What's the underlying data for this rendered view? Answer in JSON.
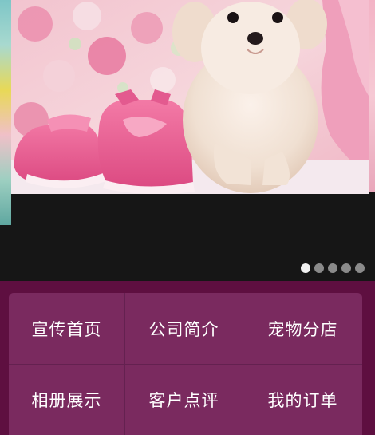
{
  "carousel": {
    "dots_count": 5,
    "active_index": 0
  },
  "menu": {
    "items": [
      {
        "label": "宣传首页"
      },
      {
        "label": "公司简介"
      },
      {
        "label": "宠物分店"
      },
      {
        "label": "相册展示"
      },
      {
        "label": "客户点评"
      },
      {
        "label": "我的订单"
      }
    ]
  },
  "colors": {
    "menu_background": "#5e0f40",
    "menu_tiles": "#7a2a5f",
    "carousel_background": "#161616",
    "dot_active": "#f2f2f2",
    "dot_inactive": "#8a8a8a"
  }
}
